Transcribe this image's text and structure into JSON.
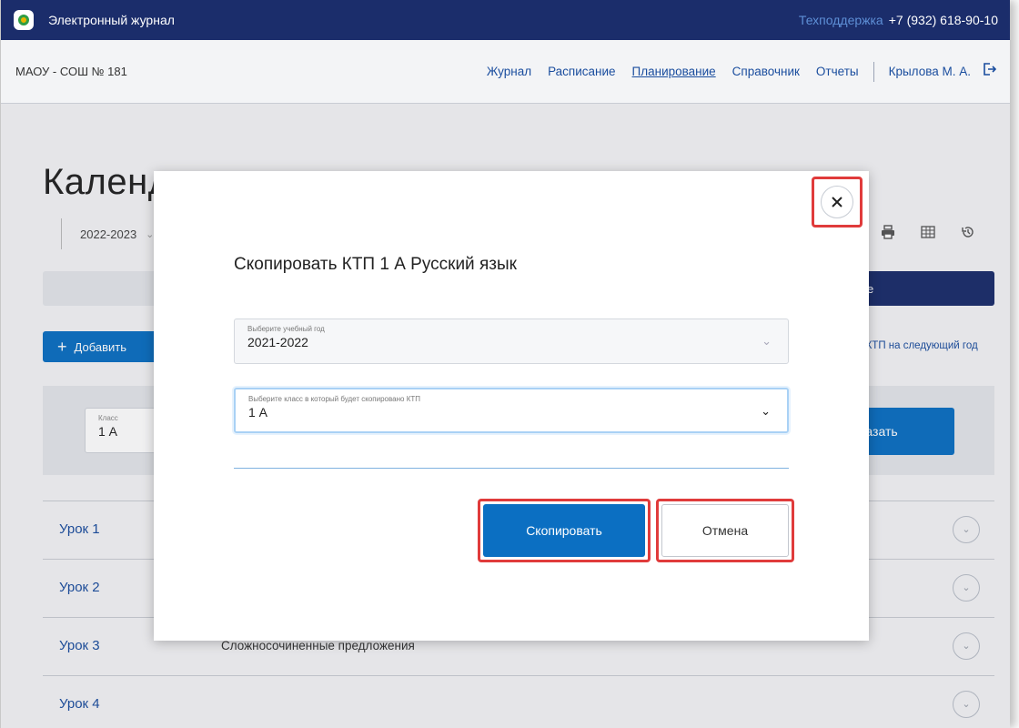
{
  "topbar": {
    "title": "Электронный журнал",
    "support_label": "Техподдержка",
    "support_phone": "+7 (932) 618-90-10"
  },
  "navbar": {
    "school": "МАОУ - СОШ № 181",
    "links": [
      "Журнал",
      "Расписание",
      "Планирование",
      "Справочник",
      "Отчеты"
    ],
    "active_link": "Планирование",
    "user": "Крылова М. А."
  },
  "page": {
    "title": "Календ",
    "year": "2022-2023",
    "add_label": "Добавить",
    "band_button": "е",
    "copy_next_year": "ать КТП на следующий год",
    "class_label": "Класс",
    "class_value": "1 А",
    "show_label": "казать",
    "lessons": [
      {
        "name": "Урок 1",
        "topic": ""
      },
      {
        "name": "Урок 2",
        "topic": ""
      },
      {
        "name": "Урок 3",
        "topic": "Сложносочиненные предложения"
      },
      {
        "name": "Урок 4",
        "topic": ""
      }
    ]
  },
  "modal": {
    "title": "Скопировать КТП 1 А Русский язык",
    "year_field": {
      "label": "Выберите учебный год",
      "value": "2021-2022"
    },
    "class_field": {
      "label": "Выберите класс в который будет скопировано КТП",
      "value": "1 А"
    },
    "copy_button": "Скопировать",
    "cancel_button": "Отмена"
  },
  "icons": {
    "logout": "logout-icon",
    "close": "close-icon",
    "chevron": "chevron-down-icon",
    "print": "print-icon",
    "excel": "excel-icon",
    "history": "history-icon"
  },
  "colors": {
    "topbar": "#1b2d6b",
    "primary": "#0b6fc2",
    "link": "#1a4d9e",
    "highlight": "#e03b3b"
  }
}
